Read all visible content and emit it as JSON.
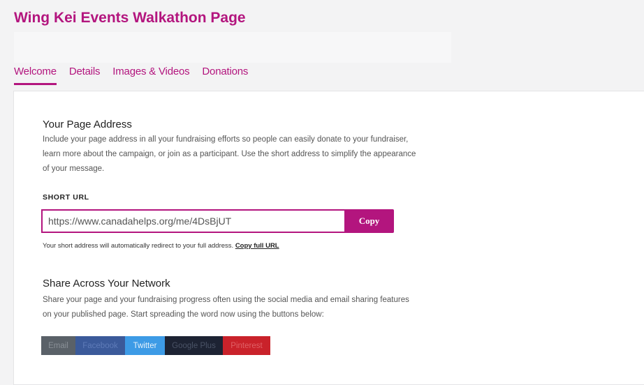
{
  "header": {
    "title": "Wing Kei Events Walkathon Page"
  },
  "tabs": [
    {
      "label": "Welcome",
      "active": true
    },
    {
      "label": "Details",
      "active": false
    },
    {
      "label": "Images & Videos",
      "active": false
    },
    {
      "label": "Donations",
      "active": false
    }
  ],
  "page_address": {
    "title": "Your Page Address",
    "description": "Include your page address in all your fundraising efforts so people can easily donate to your fundraiser, learn more about the campaign, or join as a participant. Use the short address to simplify the appearance of your message.",
    "short_url_label": "SHORT URL",
    "short_url_value": "https://www.canadahelps.org/me/4DsBjUT",
    "copy_label": "Copy",
    "redirect_note": "Your short address will automatically redirect to your full address.",
    "copy_full_url_label": "Copy full URL"
  },
  "share": {
    "title": "Share Across Your Network",
    "description": "Share your page and your fundraising progress often using the social media and email sharing features on your published page. Start spreading the word now using the buttons below:",
    "buttons": {
      "email": "Email",
      "facebook": "Facebook",
      "twitter": "Twitter",
      "google_plus": "Google Plus",
      "pinterest": "Pinterest"
    }
  },
  "colors": {
    "accent": "#b3157e",
    "email": "#5a6168",
    "facebook": "#3b5a9a",
    "twitter": "#3d9be6",
    "google_plus": "#1d2333",
    "pinterest": "#c9222a"
  }
}
